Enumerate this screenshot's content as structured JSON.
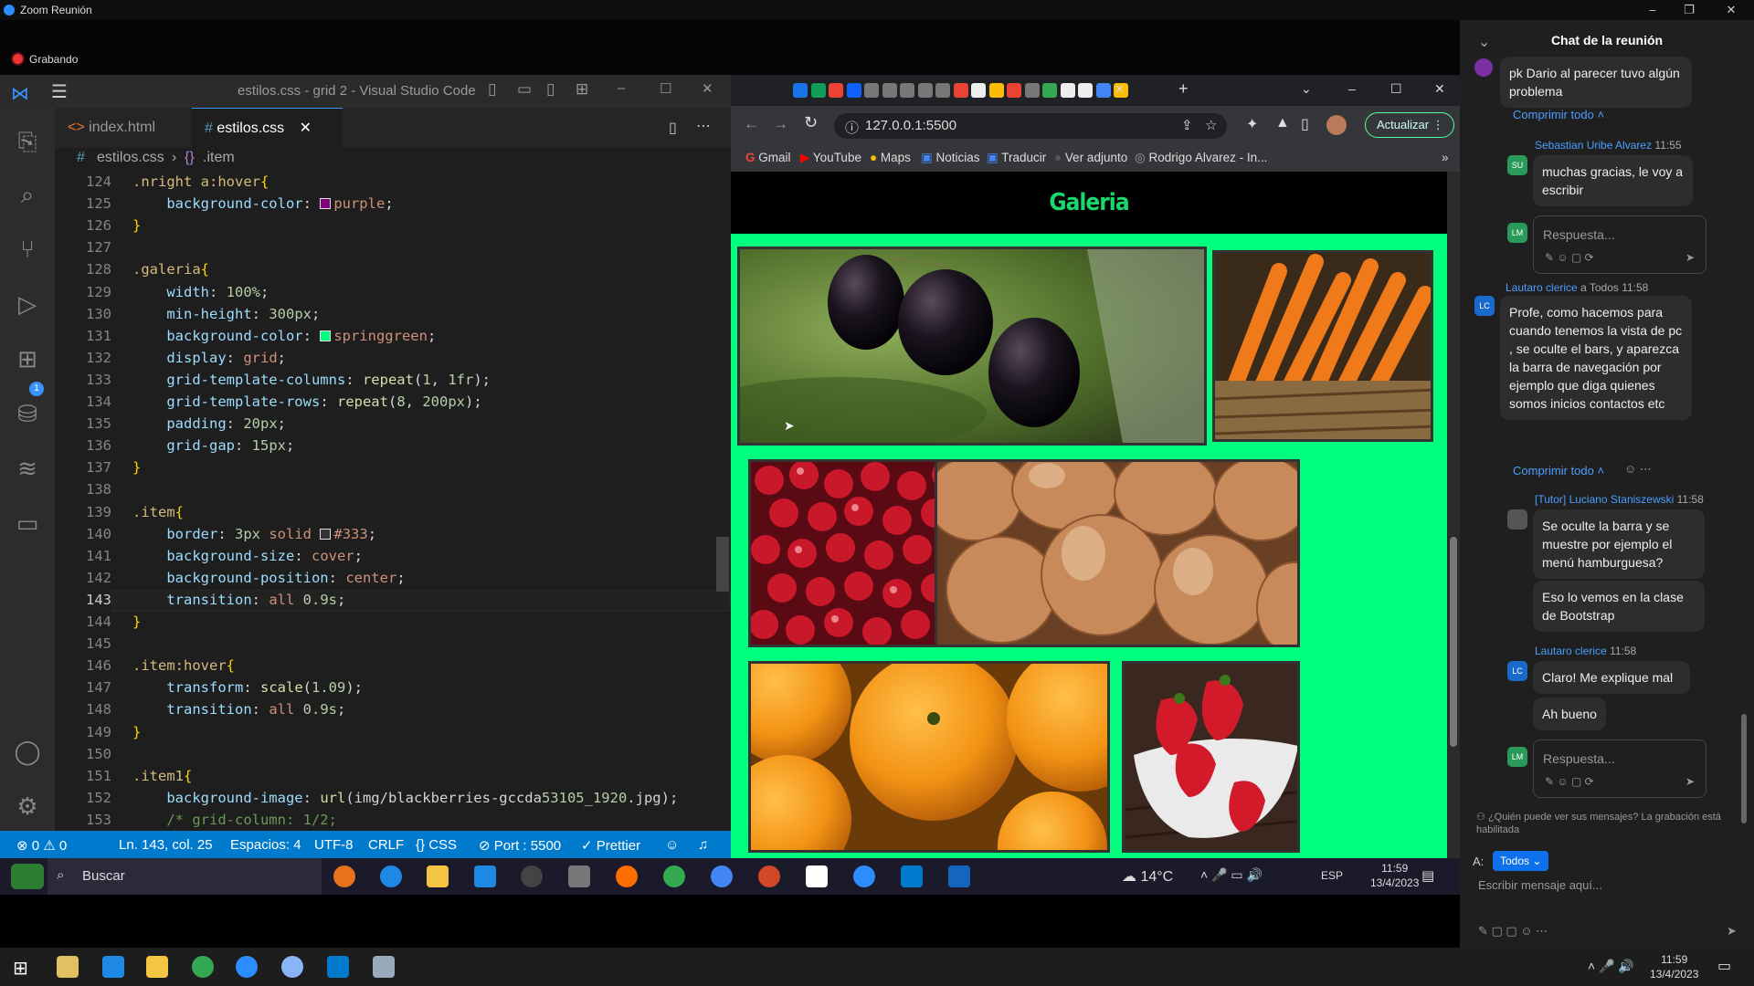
{
  "zoom": {
    "title": "Zoom Reunión",
    "recording": "Grabando"
  },
  "vscode": {
    "title": "estilos.css - grid 2 - Visual Studio Code",
    "tabs": [
      {
        "label": "index.html"
      },
      {
        "label": "estilos.css"
      }
    ],
    "breadcrumb": {
      "file": "estilos.css",
      "symbol": ".item"
    },
    "activity_badge": "1",
    "code_lines": [
      {
        "n": "124",
        "t": ".nright a:hover{"
      },
      {
        "n": "125",
        "t": "    background-color: purple;"
      },
      {
        "n": "126",
        "t": "}"
      },
      {
        "n": "127",
        "t": ""
      },
      {
        "n": "128",
        "t": ".galeria{"
      },
      {
        "n": "129",
        "t": "    width: 100%;"
      },
      {
        "n": "130",
        "t": "    min-height: 300px;"
      },
      {
        "n": "131",
        "t": "    background-color: springgreen;"
      },
      {
        "n": "132",
        "t": "    display: grid;"
      },
      {
        "n": "133",
        "t": "    grid-template-columns: repeat(1, 1fr);"
      },
      {
        "n": "134",
        "t": "    grid-template-rows: repeat(8, 200px);"
      },
      {
        "n": "135",
        "t": "    padding: 20px;"
      },
      {
        "n": "136",
        "t": "    grid-gap: 15px;"
      },
      {
        "n": "137",
        "t": "}"
      },
      {
        "n": "138",
        "t": ""
      },
      {
        "n": "139",
        "t": ".item{"
      },
      {
        "n": "140",
        "t": "    border: 3px solid #333;"
      },
      {
        "n": "141",
        "t": "    background-size: cover;"
      },
      {
        "n": "142",
        "t": "    background-position: center;"
      },
      {
        "n": "143",
        "t": "    transition: all 0.9s;"
      },
      {
        "n": "144",
        "t": "}"
      },
      {
        "n": "145",
        "t": ""
      },
      {
        "n": "146",
        "t": ".item:hover{"
      },
      {
        "n": "147",
        "t": "    transform: scale(1.09);"
      },
      {
        "n": "148",
        "t": "    transition: all 0.9s;"
      },
      {
        "n": "149",
        "t": "}"
      },
      {
        "n": "150",
        "t": ""
      },
      {
        "n": "151",
        "t": ".item1{"
      },
      {
        "n": "152",
        "t": "    background-image: url(img/blackberries-gccda53105_1920.jpg);"
      },
      {
        "n": "153",
        "t": "    /* grid-column: 1/2;"
      }
    ],
    "status": {
      "errors": "0",
      "warnings": "0",
      "position": "Ln. 143, col. 25",
      "spaces": "Espacios: 4",
      "encoding": "UTF-8",
      "eol": "CRLF",
      "lang": "CSS",
      "port": "Port : 5500",
      "prettier": "Prettier"
    }
  },
  "browser": {
    "url": "127.0.0.1:5500",
    "update_button": "Actualizar",
    "bookmarks": [
      "Gmail",
      "YouTube",
      "Maps",
      "Noticias",
      "Traducir",
      "Ver adjunto",
      "Rodrigo Alvarez - In..."
    ],
    "page_title": "Galeria"
  },
  "chat": {
    "header": "Chat de la reunión",
    "messages": [
      {
        "text": "pk Dario al parecer tuvo algún problema"
      },
      {
        "collapse": "Comprimir todo"
      },
      {
        "sender": "Sebastian Uribe Alvarez",
        "time": "11:55",
        "avatar": "SU",
        "text": "muchas gracias, le voy a escribir"
      },
      {
        "reply_placeholder": "Respuesta..."
      },
      {
        "sender": "Lautaro clerice",
        "to": "a Todos",
        "time": "11:58",
        "avatar": "LC",
        "text": "Profe, como hacemos para cuando tenemos la vista de pc , se oculte el bars, y aparezca la barra de navegación por ejemplo que diga quienes somos inicios contactos etc"
      },
      {
        "collapse": "Comprimir todo"
      },
      {
        "sender": "[Tutor] Luciano Staniszewski",
        "time": "11:58",
        "text": "Se oculte la barra y se muestre por ejemplo el menú hamburguesa?",
        "text2": "Eso lo vemos en la clase de Bootstrap"
      },
      {
        "sender": "Lautaro clerice",
        "time": "11:58",
        "avatar": "LC",
        "text": "Claro! Me explique mal",
        "text2": "Ah bueno"
      },
      {
        "reply_placeholder": "Respuesta..."
      }
    ],
    "visibility_note": "¿Quién puede ver sus mensajes? La grabación está habilitada",
    "to_label": "A:",
    "to_value": "Todos",
    "input_placeholder": "Escribir mensaje aquí...",
    "reply_avatar": "LM"
  },
  "taskbar_inner": {
    "search": "Buscar",
    "weather": "14°C",
    "lang": "ESP",
    "time": "11:59",
    "date": "13/4/2023"
  },
  "taskbar_main": {
    "time": "11:59",
    "date": "13/4/2023"
  }
}
